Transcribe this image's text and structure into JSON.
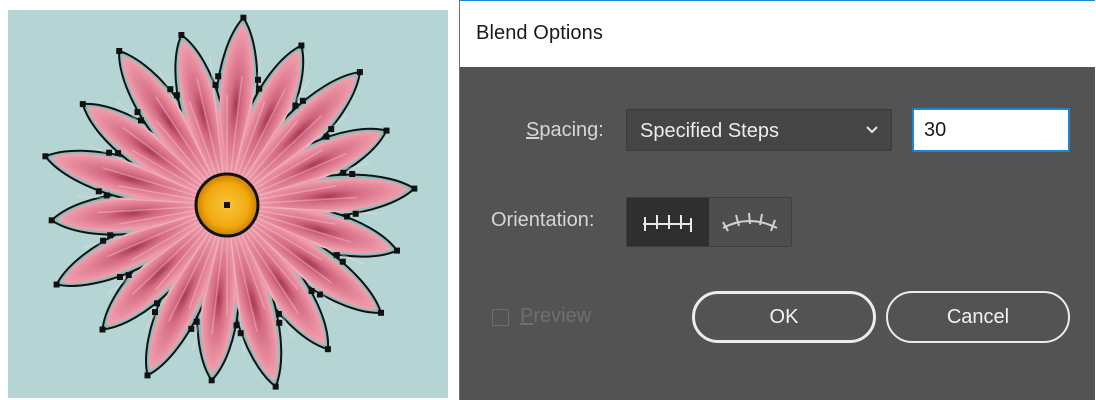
{
  "dialog": {
    "title": "Blend Options",
    "spacing": {
      "label_accesskey": "S",
      "label_rest": "pacing:",
      "selected_option": "Specified Steps",
      "steps_value": "30"
    },
    "orientation": {
      "label": "Orientation:",
      "options": [
        "align-to-page",
        "align-to-path"
      ],
      "selected": "align-to-page"
    },
    "preview": {
      "label_accesskey": "P",
      "label_rest": "review",
      "checked": false,
      "enabled": false
    },
    "buttons": {
      "ok_label": "OK",
      "cancel_label": "Cancel"
    }
  },
  "artwork": {
    "canvas_color": "#b5d5d4",
    "petal_color": "#f2a3b0",
    "center_color": "#f2a90f",
    "selected": true
  },
  "colors": {
    "dialog_bg": "#535353",
    "accent_blue": "#1c85d4",
    "label_text": "#d6d6d6"
  }
}
